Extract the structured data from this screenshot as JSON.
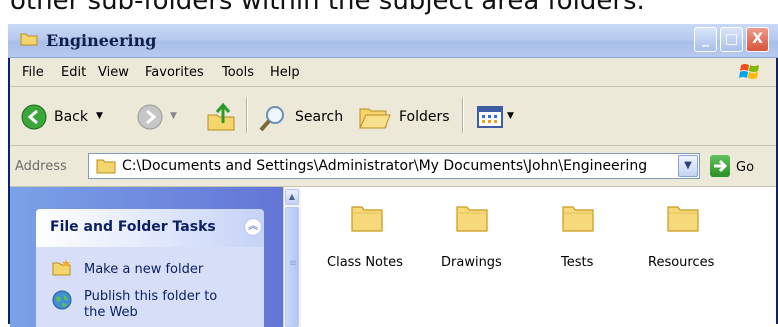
{
  "caption": "other sub-folders within the subject area folders.",
  "window": {
    "title": "Engineering",
    "controls": {
      "minimize": "_",
      "maximize": "□",
      "close": "X"
    }
  },
  "menu": [
    "File",
    "Edit",
    "View",
    "Favorites",
    "Tools",
    "Help"
  ],
  "toolbar": {
    "back_label": "Back",
    "search_label": "Search",
    "folders_label": "Folders"
  },
  "address": {
    "label": "Address",
    "value": "C:\\Documents and Settings\\Administrator\\My Documents\\John\\Engineering",
    "go_label": "Go"
  },
  "taskpane": {
    "title": "File and Folder Tasks",
    "tasks": [
      "Make a new folder",
      "Publish this folder to",
      "the Web"
    ]
  },
  "folders": [
    "Class Notes",
    "Drawings",
    "Tests",
    "Resources"
  ],
  "colors": {
    "title_bar": "#b7cbef",
    "task_pane": "#7ba2e7",
    "folder": "#f5d97a"
  }
}
